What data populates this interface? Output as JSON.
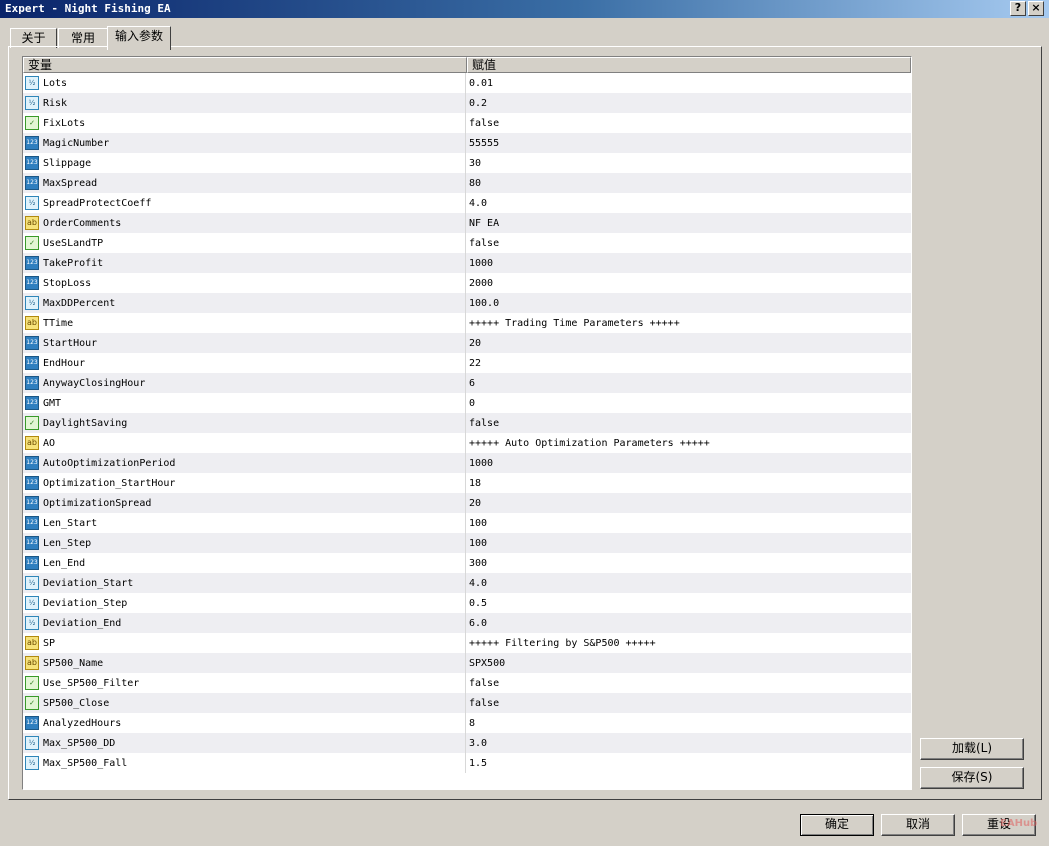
{
  "window": {
    "title": "Expert - Night Fishing EA",
    "help_label": "?",
    "close_label": "×"
  },
  "tabs": [
    {
      "label": "关于"
    },
    {
      "label": "常用"
    },
    {
      "label": "输入参数"
    }
  ],
  "active_tab": 2,
  "grid": {
    "columns": [
      "变量",
      "赋值"
    ],
    "rows": [
      {
        "type": "double",
        "name": "Lots",
        "value": "0.01"
      },
      {
        "type": "double",
        "name": "Risk",
        "value": "0.2"
      },
      {
        "type": "bool",
        "name": "FixLots",
        "value": "false"
      },
      {
        "type": "int",
        "name": "MagicNumber",
        "value": "55555"
      },
      {
        "type": "int",
        "name": "Slippage",
        "value": "30"
      },
      {
        "type": "int",
        "name": "MaxSpread",
        "value": "80"
      },
      {
        "type": "double",
        "name": "SpreadProtectCoeff",
        "value": "4.0"
      },
      {
        "type": "string",
        "name": "OrderComments",
        "value": "NF EA"
      },
      {
        "type": "bool",
        "name": "UseSLandTP",
        "value": "false"
      },
      {
        "type": "int",
        "name": "TakeProfit",
        "value": "1000"
      },
      {
        "type": "int",
        "name": "StopLoss",
        "value": "2000"
      },
      {
        "type": "double",
        "name": "MaxDDPercent",
        "value": "100.0"
      },
      {
        "type": "string",
        "name": "TTime",
        "value": "+++++ Trading Time Parameters +++++"
      },
      {
        "type": "int",
        "name": "StartHour",
        "value": "20"
      },
      {
        "type": "int",
        "name": "EndHour",
        "value": "22"
      },
      {
        "type": "int",
        "name": "AnywayClosingHour",
        "value": "6"
      },
      {
        "type": "int",
        "name": "GMT",
        "value": "0"
      },
      {
        "type": "bool",
        "name": "DaylightSaving",
        "value": "false"
      },
      {
        "type": "string",
        "name": "AO",
        "value": "+++++ Auto Optimization Parameters +++++"
      },
      {
        "type": "int",
        "name": "AutoOptimizationPeriod",
        "value": "1000"
      },
      {
        "type": "int",
        "name": "Optimization_StartHour",
        "value": "18"
      },
      {
        "type": "int",
        "name": "OptimizationSpread",
        "value": "20"
      },
      {
        "type": "int",
        "name": "Len_Start",
        "value": "100"
      },
      {
        "type": "int",
        "name": "Len_Step",
        "value": "100"
      },
      {
        "type": "int",
        "name": "Len_End",
        "value": "300"
      },
      {
        "type": "double",
        "name": "Deviation_Start",
        "value": "4.0"
      },
      {
        "type": "double",
        "name": "Deviation_Step",
        "value": "0.5"
      },
      {
        "type": "double",
        "name": "Deviation_End",
        "value": "6.0"
      },
      {
        "type": "string",
        "name": "SP",
        "value": "+++++ Filtering by S&P500 +++++"
      },
      {
        "type": "string",
        "name": "SP500_Name",
        "value": "SPX500"
      },
      {
        "type": "bool",
        "name": "Use_SP500_Filter",
        "value": "false"
      },
      {
        "type": "bool",
        "name": "SP500_Close",
        "value": "false"
      },
      {
        "type": "int",
        "name": "AnalyzedHours",
        "value": "8"
      },
      {
        "type": "double",
        "name": "Max_SP500_DD",
        "value": "3.0"
      },
      {
        "type": "double",
        "name": "Max_SP500_Fall",
        "value": "1.5"
      }
    ]
  },
  "type_icons": {
    "double": {
      "icon": "real-type-icon",
      "glyph": "½",
      "color": "#2f86b8"
    },
    "int": {
      "icon": "integer-type-icon",
      "glyph": "123",
      "color": "#2f7fbf"
    },
    "bool": {
      "icon": "boolean-type-icon",
      "glyph": "✓",
      "color": "#3a9a2a"
    },
    "string": {
      "icon": "string-type-icon",
      "glyph": "ab",
      "color": "#b08a10"
    }
  },
  "buttons": {
    "load": "加载(L)",
    "save": "保存(S)",
    "ok": "确定",
    "cancel": "取消",
    "reset": "重设"
  },
  "watermark": "EAHub"
}
